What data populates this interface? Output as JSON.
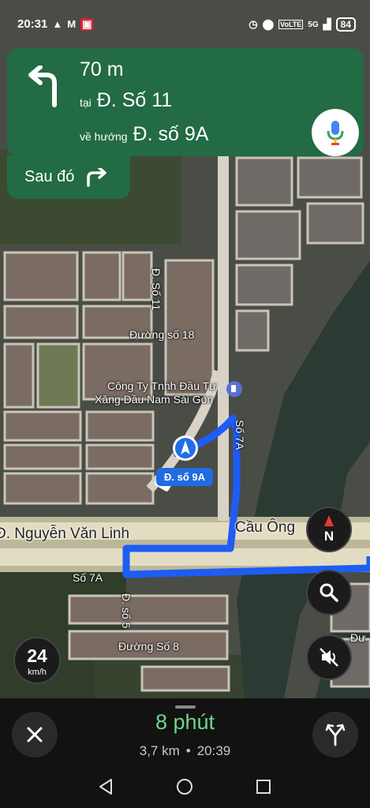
{
  "status_bar": {
    "time": "20:31",
    "left_icons": [
      "navigation-arrow-icon",
      "gmail-icon",
      "app-icon"
    ],
    "right_icons": [
      "alarm-icon",
      "location-icon",
      "volte-icon",
      "signal-icon"
    ],
    "volte": "VoLTE",
    "network": "5G",
    "battery": "84"
  },
  "instruction": {
    "distance": "70 m",
    "at_prefix": "tại",
    "street": "Đ. Số 11",
    "toward_prefix": "về hướng",
    "toward_street": "Đ. số 9A",
    "then_label": "Sau đó",
    "maneuver_icon": "turn-left-icon",
    "then_icon": "turn-right-icon"
  },
  "map": {
    "labels": {
      "duong_so_11": "Đ. Số 11",
      "duong_so_18": "Đường số 18",
      "company_line1": "Công Ty Tnhh Đầu Tư",
      "company_line2": "Xăng Dầu Nam Sài Gòn",
      "so_7a_vertical": "Số 7A",
      "so_7a": "Số 7A",
      "pill": "Đ. số 9A",
      "nguyen_van_linh": "Đ. Nguyễn Văn Linh",
      "cau_ong": "Cầu Ông",
      "d_so_5": "Đ. số 5",
      "duong_so_8": "Đường Số 8",
      "edge_d": "Đư"
    },
    "compass_letter": "N",
    "route_color": "#1e5cf6",
    "banner_color": "#226b44"
  },
  "speed": {
    "value": "24",
    "unit": "km/h"
  },
  "trip": {
    "eta_duration": "8 phút",
    "distance": "3,7 km",
    "separator": "•",
    "arrival_time": "20:39"
  }
}
